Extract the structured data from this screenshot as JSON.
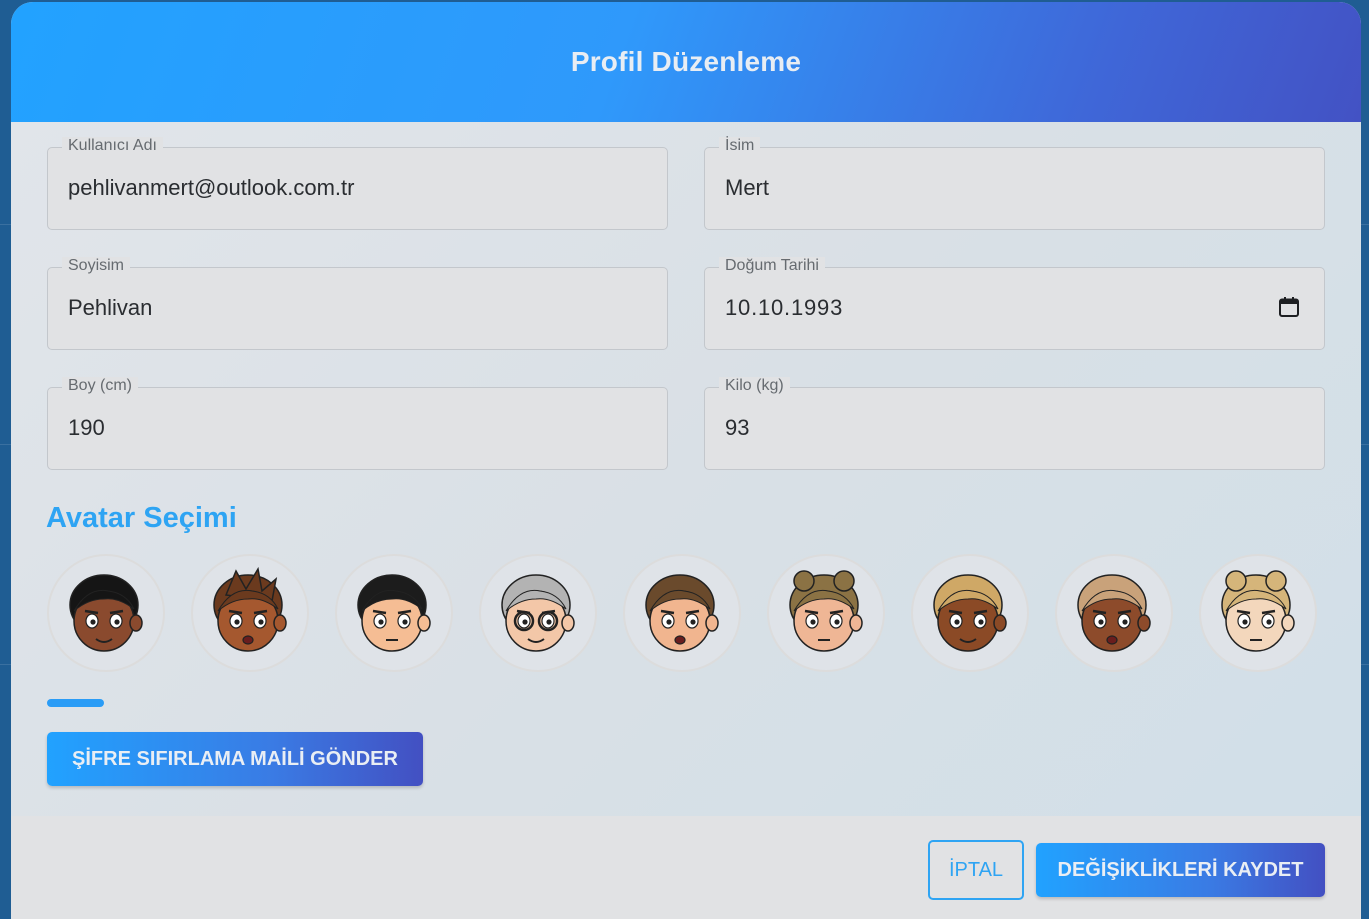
{
  "dialog": {
    "title": "Profil Düzenleme"
  },
  "form": {
    "username": {
      "label": "Kullanıcı Adı",
      "value": "pehlivanmert@outlook.com.tr"
    },
    "first_name": {
      "label": "İsim",
      "value": "Mert"
    },
    "last_name": {
      "label": "Soyisim",
      "value": "Pehlivan"
    },
    "birth_date": {
      "label": "Doğum Tarihi",
      "value": "10.10.1993"
    },
    "height": {
      "label": "Boy (cm)",
      "value": "190"
    },
    "weight": {
      "label": "Kilo (kg)",
      "value": "93"
    }
  },
  "avatars": {
    "heading": "Avatar Seçimi",
    "items": [
      {
        "icon": "avatar-curly-dark-hair-girl-icon",
        "skin": "#8a4a2e",
        "hair": "#151515"
      },
      {
        "icon": "avatar-spiky-hair-boy-icon",
        "skin": "#a5582f",
        "hair": "#6b3a1e"
      },
      {
        "icon": "avatar-short-black-hair-boy-icon",
        "skin": "#f5bd94",
        "hair": "#1c1c1c"
      },
      {
        "icon": "avatar-grey-hair-glasses-icon",
        "skin": "#f3c7a8",
        "hair": "#b3b3b3"
      },
      {
        "icon": "avatar-angry-brown-hair-boy-icon",
        "skin": "#f1b58f",
        "hair": "#6a4a2c"
      },
      {
        "icon": "avatar-bun-hair-girl-icon",
        "skin": "#efb695",
        "hair": "#8b7244"
      },
      {
        "icon": "avatar-blonde-bob-girl-icon",
        "skin": "#8b4a26",
        "hair": "#cfa866"
      },
      {
        "icon": "avatar-short-blonde-hair-icon",
        "skin": "#8d4b2b",
        "hair": "#c9a27a"
      },
      {
        "icon": "avatar-blonde-buns-girl-icon",
        "skin": "#f3d7bc",
        "hair": "#d5b57a"
      }
    ]
  },
  "actions": {
    "reset_password": "ŞİFRE SIFIRLAMA MAİLİ GÖNDER",
    "cancel": "İPTAL",
    "save": "DEĞİŞİKLİKLERİ KAYDET"
  },
  "colors": {
    "accent": "#2ea4f3",
    "gradient_start": "#21a2ff",
    "gradient_end": "#4350c2"
  }
}
